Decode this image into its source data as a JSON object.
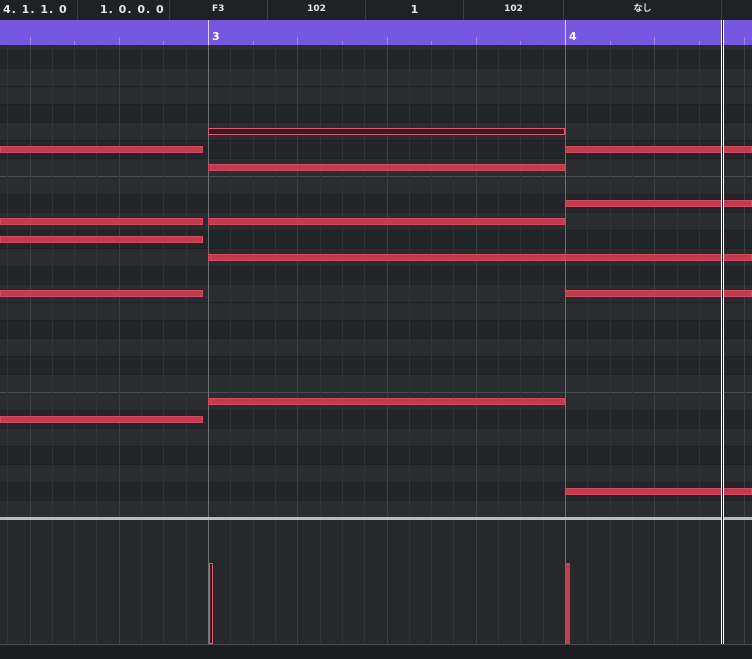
{
  "info_line": {
    "fields": [
      {
        "name": "start-position-field",
        "value": "4. 1. 1.   0",
        "style": "left pos"
      },
      {
        "name": "length-field",
        "value": "1. 0. 0.   0",
        "style": "left pos"
      },
      {
        "name": "pitch-field",
        "value": "F3",
        "style": "left"
      },
      {
        "name": "velocity-field",
        "value": "102",
        "style": "center"
      },
      {
        "name": "channel-field",
        "value": "1",
        "style": "center"
      },
      {
        "name": "off-velocity-field",
        "value": "102",
        "style": "center"
      },
      {
        "name": "articulation-field",
        "value": "なし",
        "style": "center"
      }
    ]
  },
  "ruler": {
    "bars": [
      {
        "label": "3",
        "position_bars": 3
      },
      {
        "label": "4",
        "position_bars": 4
      }
    ],
    "view_start_bars": 2.415,
    "view_end_bars": 4.52
  },
  "note_grid": {
    "top_pitch": 66,
    "bottom_pitch": 41,
    "pitch_height": "key rows"
  },
  "notes": [
    {
      "pitch": 61,
      "start": 2.4,
      "length": 0.585,
      "selected": false
    },
    {
      "pitch": 57,
      "start": 2.4,
      "length": 0.585,
      "selected": false
    },
    {
      "pitch": 56,
      "start": 2.4,
      "length": 0.585,
      "selected": false
    },
    {
      "pitch": 53,
      "start": 2.4,
      "length": 0.585,
      "selected": false
    },
    {
      "pitch": 46,
      "start": 2.4,
      "length": 0.585,
      "selected": false
    },
    {
      "pitch": 62,
      "start": 3.0,
      "length": 1.0,
      "selected": true
    },
    {
      "pitch": 60,
      "start": 3.0,
      "length": 1.0,
      "selected": false
    },
    {
      "pitch": 57,
      "start": 3.0,
      "length": 1.0,
      "selected": false
    },
    {
      "pitch": 55,
      "start": 3.0,
      "length": 1.0,
      "selected": false
    },
    {
      "pitch": 47,
      "start": 3.0,
      "length": 1.0,
      "selected": false
    },
    {
      "pitch": 61,
      "start": 4.0,
      "length": 0.6,
      "selected": false
    },
    {
      "pitch": 58,
      "start": 4.0,
      "length": 0.6,
      "selected": false
    },
    {
      "pitch": 55,
      "start": 4.0,
      "length": 0.6,
      "selected": false
    },
    {
      "pitch": 53,
      "start": 4.0,
      "length": 0.6,
      "selected": false
    },
    {
      "pitch": 42,
      "start": 4.0,
      "length": 0.6,
      "selected": false
    }
  ],
  "velocity_lane": {
    "events": [
      {
        "position_bars": 3.0,
        "velocity": 102,
        "selected": true
      },
      {
        "position_bars": 4.0,
        "velocity": 102,
        "selected": false
      }
    ],
    "max_velocity": 127
  },
  "playhead": {
    "position_bars": 4.44
  },
  "colors": {
    "ruler": "#7657e0",
    "note": "#c43a4f",
    "selected_note_outline": "#e05a6e",
    "background": "#26282c"
  }
}
